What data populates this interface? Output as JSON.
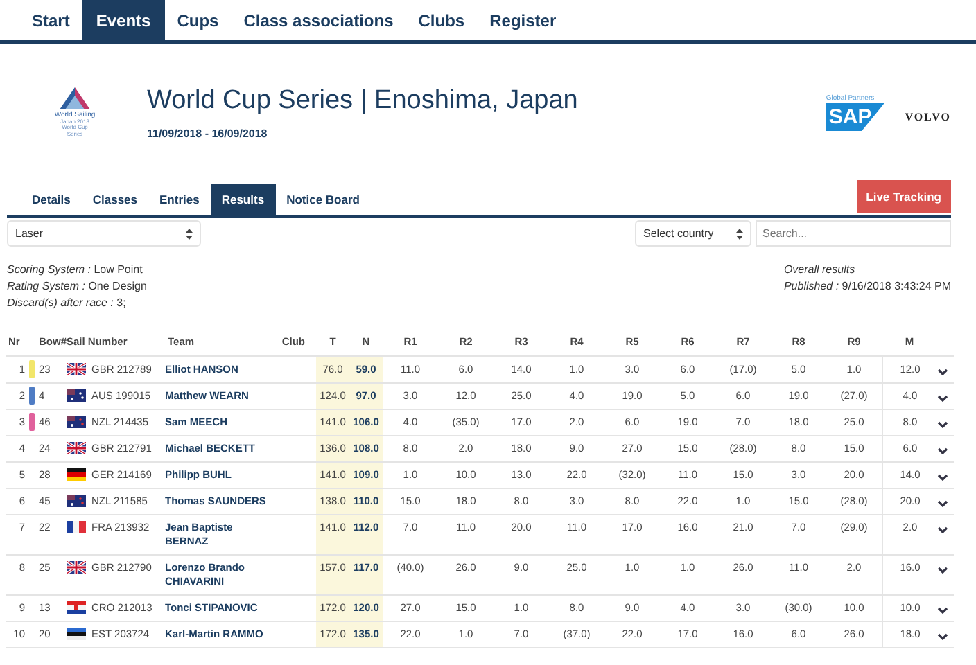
{
  "nav": [
    {
      "label": "Start",
      "selected": false
    },
    {
      "label": "Events",
      "selected": true
    },
    {
      "label": "Cups",
      "selected": false
    },
    {
      "label": "Class associations",
      "selected": false
    },
    {
      "label": "Clubs",
      "selected": false
    },
    {
      "label": "Register",
      "selected": false
    }
  ],
  "event": {
    "logo_name": "World Sailing",
    "logo_sub": "Japan 2018 World Cup Series",
    "title": "World Cup Series | Enoshima, Japan",
    "dates": "11/09/2018 - 16/09/2018"
  },
  "partners": {
    "label": "Global Partners",
    "logos": [
      "SAP",
      "VOLVO"
    ]
  },
  "tabs": [
    {
      "label": "Details",
      "selected": false
    },
    {
      "label": "Classes",
      "selected": false
    },
    {
      "label": "Entries",
      "selected": false
    },
    {
      "label": "Results",
      "selected": true
    },
    {
      "label": "Notice Board",
      "selected": false
    }
  ],
  "live_button": "Live Tracking",
  "class_select": "Laser",
  "country_select": "Select country",
  "search": {
    "placeholder": "Search..."
  },
  "info_left": [
    "*Scoring System :* Low Point",
    "*Rating System :* One Design",
    "*Discard(s) after race :* 3;"
  ],
  "info_right": [
    "Overall results",
    "*Published :* 9/16/2018 3:43:24 PM"
  ],
  "table": {
    "columns": [
      "Nr",
      "Bow#",
      "Sail Number",
      "Team",
      "Club",
      "T",
      "N",
      "R1",
      "R2",
      "R3",
      "R4",
      "R5",
      "R6",
      "R7",
      "R8",
      "R9",
      "M"
    ],
    "rows": [
      {
        "nr": "1",
        "color": "#f2e66a",
        "bow": "23",
        "kind": "gbr",
        "sail": "GBR 212789",
        "team": "Elliot HANSON",
        "t": "76.0",
        "n": "59.0",
        "races": [
          "11.0",
          "6.0",
          "14.0",
          "1.0",
          "3.0",
          "6.0",
          "(17.0)",
          "5.0",
          "1.0"
        ],
        "m": "12.0"
      },
      {
        "nr": "2",
        "color": "#4f7cc4",
        "bow": "4",
        "kind": "aus",
        "sail": "AUS 199015",
        "team": "Matthew WEARN",
        "t": "124.0",
        "n": "97.0",
        "races": [
          "3.0",
          "12.0",
          "25.0",
          "4.0",
          "19.0",
          "5.0",
          "6.0",
          "19.0",
          "(27.0)"
        ],
        "m": "4.0"
      },
      {
        "nr": "3",
        "color": "#e0619c",
        "bow": "46",
        "kind": "nzl",
        "sail": "NZL 214435",
        "team": "Sam MEECH",
        "t": "141.0",
        "n": "106.0",
        "races": [
          "4.0",
          "(35.0)",
          "17.0",
          "2.0",
          "6.0",
          "19.0",
          "7.0",
          "18.0",
          "25.0"
        ],
        "m": "8.0"
      },
      {
        "nr": "4",
        "bow": "24",
        "kind": "gbr",
        "sail": "GBR 212791",
        "team": "Michael BECKETT",
        "t": "136.0",
        "n": "108.0",
        "races": [
          "8.0",
          "2.0",
          "18.0",
          "9.0",
          "27.0",
          "15.0",
          "(28.0)",
          "8.0",
          "15.0"
        ],
        "m": "6.0"
      },
      {
        "nr": "5",
        "bow": "28",
        "kind": "ger",
        "sail": "GER 214169",
        "team": "Philipp BUHL",
        "t": "141.0",
        "n": "109.0",
        "races": [
          "1.0",
          "10.0",
          "13.0",
          "22.0",
          "(32.0)",
          "11.0",
          "15.0",
          "3.0",
          "20.0"
        ],
        "m": "14.0"
      },
      {
        "nr": "6",
        "bow": "45",
        "kind": "nzl",
        "sail": "NZL 211585",
        "team": "Thomas SAUNDERS",
        "t": "138.0",
        "n": "110.0",
        "races": [
          "15.0",
          "18.0",
          "8.0",
          "3.0",
          "8.0",
          "22.0",
          "1.0",
          "15.0",
          "(28.0)"
        ],
        "m": "20.0"
      },
      {
        "nr": "7",
        "bow": "22",
        "kind": "fra",
        "sail": "FRA 213932",
        "team": "Jean Baptiste BERNAZ",
        "t": "141.0",
        "n": "112.0",
        "races": [
          "7.0",
          "11.0",
          "20.0",
          "11.0",
          "17.0",
          "16.0",
          "21.0",
          "7.0",
          "(29.0)"
        ],
        "m": "2.0"
      },
      {
        "nr": "8",
        "bow": "25",
        "kind": "gbr",
        "sail": "GBR 212790",
        "team": "Lorenzo Brando CHIAVARINI",
        "t": "157.0",
        "n": "117.0",
        "races": [
          "(40.0)",
          "26.0",
          "9.0",
          "25.0",
          "1.0",
          "1.0",
          "26.0",
          "11.0",
          "2.0"
        ],
        "m": "16.0"
      },
      {
        "nr": "9",
        "bow": "13",
        "kind": "cro",
        "sail": "CRO 212013",
        "team": "Tonci STIPANOVIC",
        "t": "172.0",
        "n": "120.0",
        "races": [
          "27.0",
          "15.0",
          "1.0",
          "8.0",
          "9.0",
          "4.0",
          "3.0",
          "(30.0)",
          "10.0"
        ],
        "m": "10.0"
      },
      {
        "nr": "10",
        "bow": "20",
        "kind": "est",
        "sail": "EST 203724",
        "team": "Karl-Martin RAMMO",
        "t": "172.0",
        "n": "135.0",
        "races": [
          "22.0",
          "1.0",
          "7.0",
          "(37.0)",
          "22.0",
          "17.0",
          "16.0",
          "6.0",
          "26.0"
        ],
        "m": "18.0"
      }
    ]
  }
}
